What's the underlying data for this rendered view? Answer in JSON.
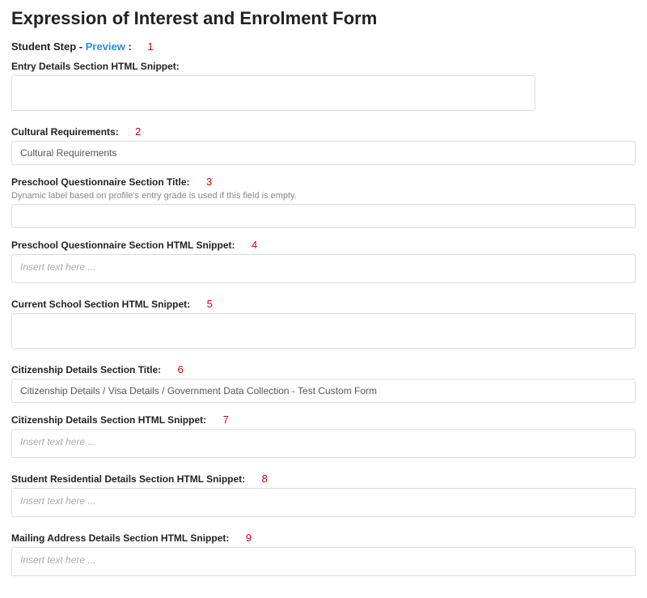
{
  "page_title": "Expression of Interest and Enrolment Form",
  "step": {
    "prefix": "Student Step - ",
    "preview_label": "Preview",
    "suffix": " :"
  },
  "annotations": {
    "a1": "1",
    "a2": "2",
    "a3": "3",
    "a4": "4",
    "a5": "5",
    "a6": "6",
    "a7": "7",
    "a8": "8",
    "a9": "9"
  },
  "fields": {
    "entry_details": {
      "label": "Entry Details Section HTML Snippet:",
      "value": ""
    },
    "cultural_requirements": {
      "label": "Cultural Requirements:",
      "value": "Cultural Requirements"
    },
    "preschool_title": {
      "label": "Preschool Questionnaire Section Title:",
      "help": "Dynamic label based on profile's entry grade is used if this field is empty.",
      "value": ""
    },
    "preschool_snippet": {
      "label": "Preschool Questionnaire Section HTML Snippet:",
      "placeholder": "Insert text here ..."
    },
    "current_school_snippet": {
      "label": "Current School Section HTML Snippet:",
      "value": ""
    },
    "citizenship_title": {
      "label": "Citizenship Details Section Title:",
      "value": "Citizenship Details / Visa Details / Government Data Collection - Test Custom Form"
    },
    "citizenship_snippet": {
      "label": "Citizenship Details Section HTML Snippet:",
      "placeholder": "Insert text here ..."
    },
    "residential_snippet": {
      "label": "Student Residential Details Section HTML Snippet:",
      "placeholder": "Insert text here ..."
    },
    "mailing_snippet": {
      "label": "Mailing Address Details Section HTML Snippet:",
      "placeholder": "Insert text here ..."
    }
  }
}
